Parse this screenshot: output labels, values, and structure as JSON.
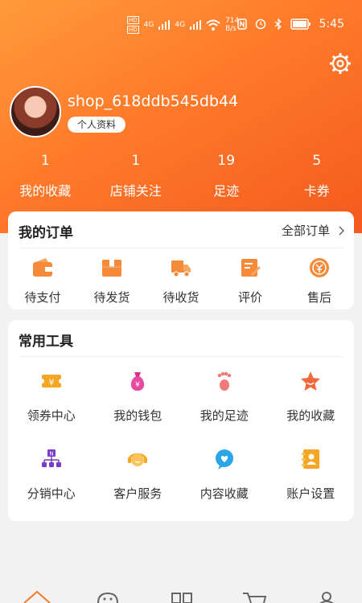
{
  "status_bar": {
    "speed_value": "714",
    "speed_unit": "B/s",
    "time": "5:45",
    "hd1": "HD",
    "hd2": "HD",
    "net1": "4G",
    "net2": "4G"
  },
  "profile": {
    "username": "shop_618ddb545db44",
    "profile_button": "个人资料"
  },
  "stats": [
    {
      "value": "1",
      "label": "我的收藏"
    },
    {
      "value": "1",
      "label": "店铺关注"
    },
    {
      "value": "19",
      "label": "足迹"
    },
    {
      "value": "5",
      "label": "卡券"
    }
  ],
  "orders": {
    "title": "我的订单",
    "all_link": "全部订单",
    "items": [
      {
        "label": "待支付",
        "icon": "wallet-icon"
      },
      {
        "label": "待发货",
        "icon": "package-icon"
      },
      {
        "label": "待收货",
        "icon": "truck-icon"
      },
      {
        "label": "评价",
        "icon": "review-icon"
      },
      {
        "label": "售后",
        "icon": "after-sales-icon"
      }
    ]
  },
  "tools": {
    "title": "常用工具",
    "items": [
      {
        "label": "领券中心",
        "icon": "coupon-icon"
      },
      {
        "label": "我的钱包",
        "icon": "money-bag-icon"
      },
      {
        "label": "我的足迹",
        "icon": "footprint-icon"
      },
      {
        "label": "我的收藏",
        "icon": "star-icon"
      },
      {
        "label": "分销中心",
        "icon": "distribution-icon"
      },
      {
        "label": "客户服务",
        "icon": "customer-service-icon"
      },
      {
        "label": "内容收藏",
        "icon": "chat-heart-icon"
      },
      {
        "label": "账户设置",
        "icon": "address-book-icon"
      }
    ]
  },
  "colors": {
    "brand_orange": "#ff7a2a",
    "icon_orange": "#f48a3a",
    "icon_purple": "#7a3cc8",
    "icon_blue": "#2aa6e8"
  }
}
